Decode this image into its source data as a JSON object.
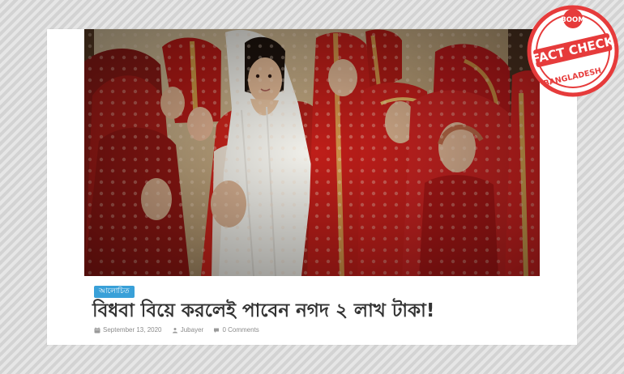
{
  "article": {
    "category": "আলোচিত",
    "headline": "বিধবা বিয়ে করলেই পাবেন নগদ ২ লাখ টাকা!",
    "date": "September 13, 2020",
    "author": "Jubayer",
    "comments": "0 Comments"
  },
  "stamp": {
    "top_text": "BOOM",
    "main_text": "FACT CHECK",
    "bottom_text": "BANGLADESH"
  },
  "icons": {
    "date": "calendar-icon",
    "author": "user-icon",
    "comments": "comment-icon"
  },
  "colors": {
    "tag": "#39a0d8",
    "stamp": "#e63b3b",
    "headline": "#333333",
    "meta": "#8b8b8b"
  }
}
